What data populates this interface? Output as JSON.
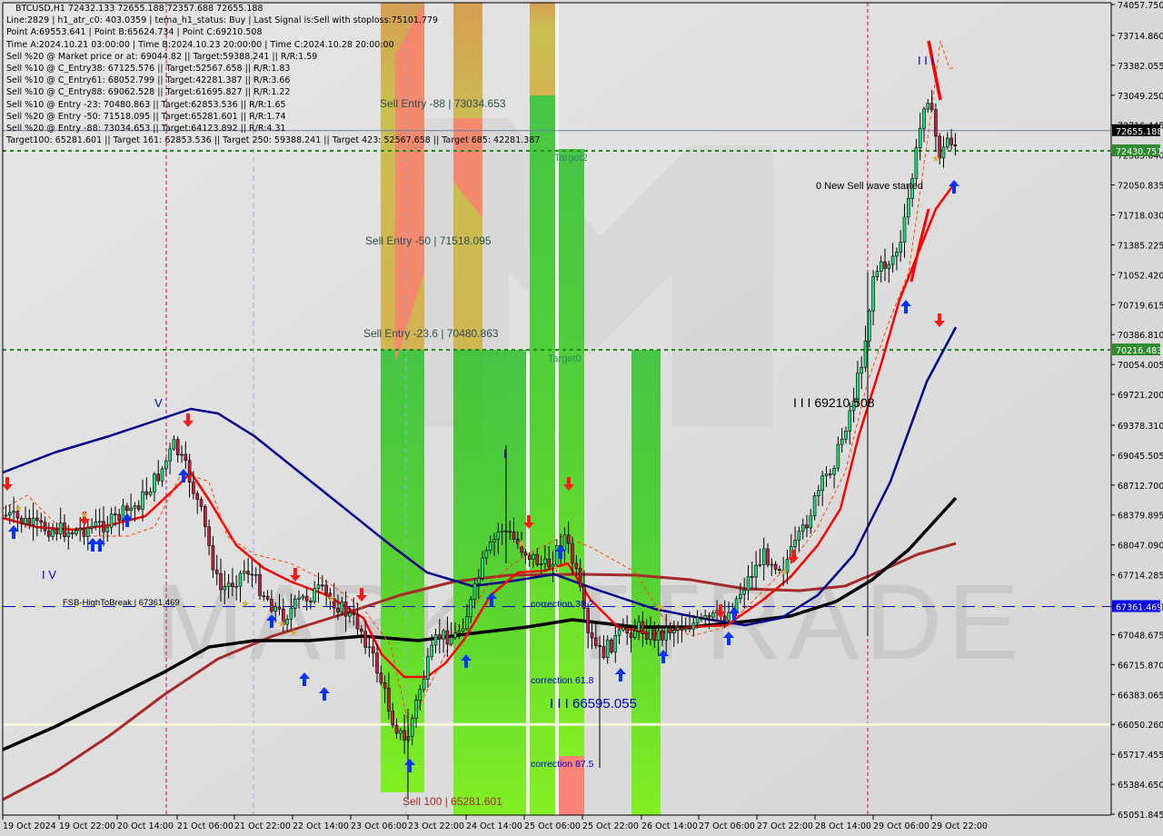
{
  "header": {
    "symbol_line": "BTCUSD,H1  72432.133 72655.188 72357.688 72655.188",
    "lines": [
      "Line:2829 | h1_atr_c0: 403.0359 | tema_h1_status: Buy | Last Signal is:Sell with stoploss:75101.779",
      "Point A:69553.641 | Point B:65624.734 | Point C:69210.508",
      "Time A:2024.10.21 03:00:00 | Time B:2024.10.23 20:00:00 | Time C:2024.10.28 20:00:00",
      "Sell %20 @ Market price or at: 69044.82 || Target:59388.241 || R/R:1.59",
      "Sell %10 @ C_Entry38: 67125.576 || Target:52567.658 || R/R:1.83",
      "Sell %10 @ C_Entry61: 68052.799 || Target:42281.387 || R/R:3.66",
      "Sell %10 @ C_Entry88: 69062.528 || Target:61695.827 || R/R:1.22",
      "Sell %10 @ Entry -23: 70480.863 || Target:62853.536 || R/R:1.65",
      "Sell %20 @ Entry -50: 71518.095 || Target:65281.601 || R/R:1.74",
      "Sell %20 @ Entry -88: 73034.653 || Target:64123.892 || R/R:4.31",
      "Target100: 65281.601 || Target 161: 62853.536 || Target 250: 59388.241 || Target 423: 52567.658 || Target 685: 42281.387"
    ]
  },
  "chart_data": {
    "type": "candlestick",
    "symbol": "BTCUSD",
    "timeframe": "H1",
    "ohlc_last": {
      "open": 72432.133,
      "high": 72655.188,
      "low": 72357.688,
      "close": 72655.188
    },
    "ylim": [
      64900,
      74150
    ],
    "y_ticks": [
      "74057.750",
      "73714.860",
      "73382.055",
      "73049.250",
      "72716.445",
      "72383.640",
      "72050.835",
      "71718.030",
      "71385.225",
      "71052.420",
      "70719.615",
      "70386.810",
      "70054.005",
      "69721.200",
      "69378.310",
      "69045.505",
      "68712.700",
      "68379.895",
      "68047.090",
      "67714.285",
      "67361.469",
      "67048.675",
      "66715.870",
      "66383.065",
      "66050.260",
      "65717.455",
      "65384.650",
      "65051.845"
    ],
    "x_ticks": [
      "19 Oct 2024",
      "19 Oct 22:00",
      "20 Oct 14:00",
      "21 Oct 06:00",
      "21 Oct 22:00",
      "22 Oct 14:00",
      "23 Oct 06:00",
      "23 Oct 22:00",
      "24 Oct 14:00",
      "25 Oct 06:00",
      "25 Oct 22:00",
      "26 Oct 14:00",
      "27 Oct 06:00",
      "27 Oct 22:00",
      "28 Oct 14:00",
      "29 Oct 06:00",
      "29 Oct 22:00"
    ],
    "price_tags": [
      {
        "value": 72655.188,
        "label": "72655.188",
        "bg": "#000000",
        "fg": "#ffffff"
      },
      {
        "value": 72430.751,
        "label": "72430.751",
        "bg": "#2e8b2e",
        "fg": "#ffffff"
      },
      {
        "value": 70216.483,
        "label": "70216.483",
        "bg": "#2e8b2e",
        "fg": "#ffffff"
      },
      {
        "value": 67361.469,
        "label": "67361.469",
        "bg": "#0000ee",
        "fg": "#ffffff"
      }
    ],
    "horizontal_lines": [
      {
        "name": "current-price-line",
        "value": 72655.188,
        "color": "#7080a0",
        "style": "solid"
      },
      {
        "name": "target2-line",
        "value": 72430.751,
        "color": "#1e8a1e",
        "style": "dotted"
      },
      {
        "name": "target0-line",
        "value": 70216.483,
        "color": "#1e8a1e",
        "style": "dotted"
      },
      {
        "name": "fsb-high-to-break-line",
        "value": 67361.469,
        "color": "#0000cc",
        "style": "dashed"
      },
      {
        "name": "support-line",
        "value": 66050.26,
        "color": "#f8f8d8",
        "style": "solid"
      }
    ],
    "annotations": [
      {
        "text": "Sell Entry -88 | 73034.653",
        "value": 73034.653,
        "color": "#2f4f4f"
      },
      {
        "text": "Sell Entry -50 | 71518.095",
        "value": 71518.095,
        "color": "#2f4f4f"
      },
      {
        "text": "Sell Entry -23.6 | 70480.863",
        "value": 70480.863,
        "color": "#2f4f4f"
      },
      {
        "text": "Sell 100 | 65281.601",
        "value": 65281.601,
        "color": "#a52a2a"
      },
      {
        "text": "Target2",
        "color": "#2e8b57"
      },
      {
        "text": "Target0",
        "color": "#2e8b57"
      },
      {
        "text": "correction 38.2",
        "color": "#0000cc"
      },
      {
        "text": "correction 61.8",
        "color": "#0000cc"
      },
      {
        "text": "correction 87.5",
        "color": "#0000cc"
      },
      {
        "text": "I I I 66595.055",
        "color": "#0000cc"
      },
      {
        "text": "I I I 69210.508",
        "color": "#000000"
      },
      {
        "text": "0 New Sell wave started",
        "color": "#000000"
      },
      {
        "text": "FSB-HighToBreak | 67361.469",
        "color": "#000000"
      },
      {
        "text": "V",
        "color": "#0000cc"
      },
      {
        "text": "I V",
        "color": "#0000cc"
      },
      {
        "text": "I",
        "color": "#0000cc"
      },
      {
        "text": "I I I",
        "color": "#0000cc"
      }
    ],
    "watermark": "MARKETTRADE",
    "series": [
      {
        "name": "MA-fast (red)",
        "color": "#ff0000"
      },
      {
        "name": "MA-mid (navy)",
        "color": "#00008b"
      },
      {
        "name": "MA-slow (black)",
        "color": "#000000"
      },
      {
        "name": "MA-long (brown)",
        "color": "#a52a2a"
      },
      {
        "name": "Trailing stop (orange dashed)",
        "color": "#ff4500"
      }
    ]
  }
}
